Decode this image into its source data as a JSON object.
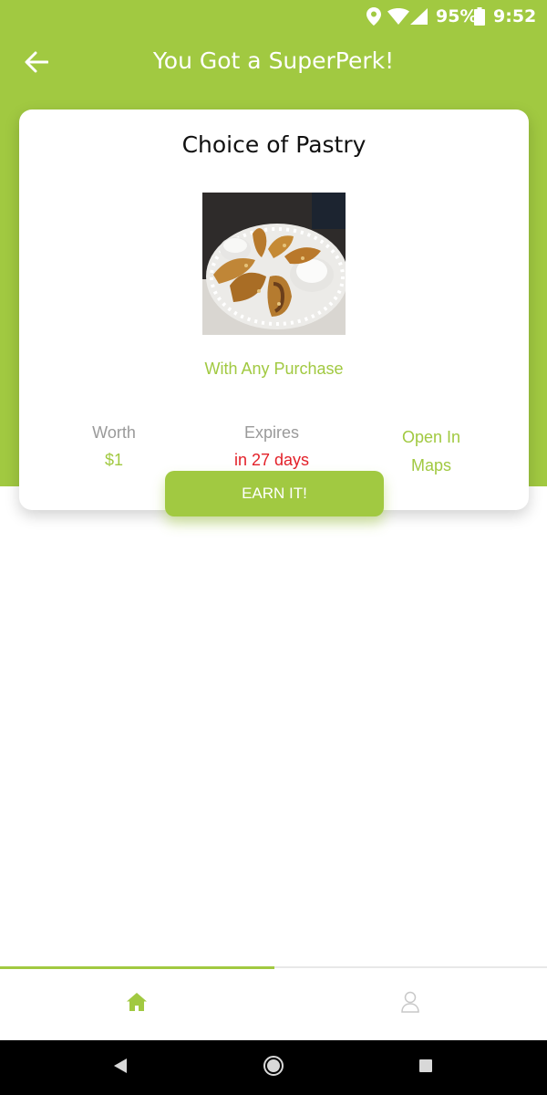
{
  "status_bar": {
    "battery": "95%",
    "time": "9:52",
    "icons": [
      "location-icon",
      "wifi-icon",
      "signal-icon",
      "battery-icon"
    ]
  },
  "header": {
    "title": "You Got a SuperPerk!",
    "back_icon": "arrow-left-icon"
  },
  "perk": {
    "title": "Choice of Pastry",
    "image": "pastry-photo",
    "subtitle": "With Any Purchase",
    "worth_label": "Worth",
    "worth_value": "$1",
    "expires_label": "Expires",
    "expires_value": "in 27 days",
    "maps_line1": "Open In",
    "maps_line2": "Maps"
  },
  "earn_button": {
    "label": "EARN IT!"
  },
  "bottom_nav": {
    "tabs": [
      {
        "name": "home",
        "icon": "home-icon",
        "active": true
      },
      {
        "name": "profile",
        "icon": "user-icon",
        "active": false
      }
    ]
  },
  "system_nav": {
    "buttons": [
      "back-triangle-icon",
      "home-circle-icon",
      "recents-square-icon"
    ]
  },
  "colors": {
    "accent": "#a1c941",
    "expires": "#e32028",
    "muted": "#9a9a9a"
  }
}
